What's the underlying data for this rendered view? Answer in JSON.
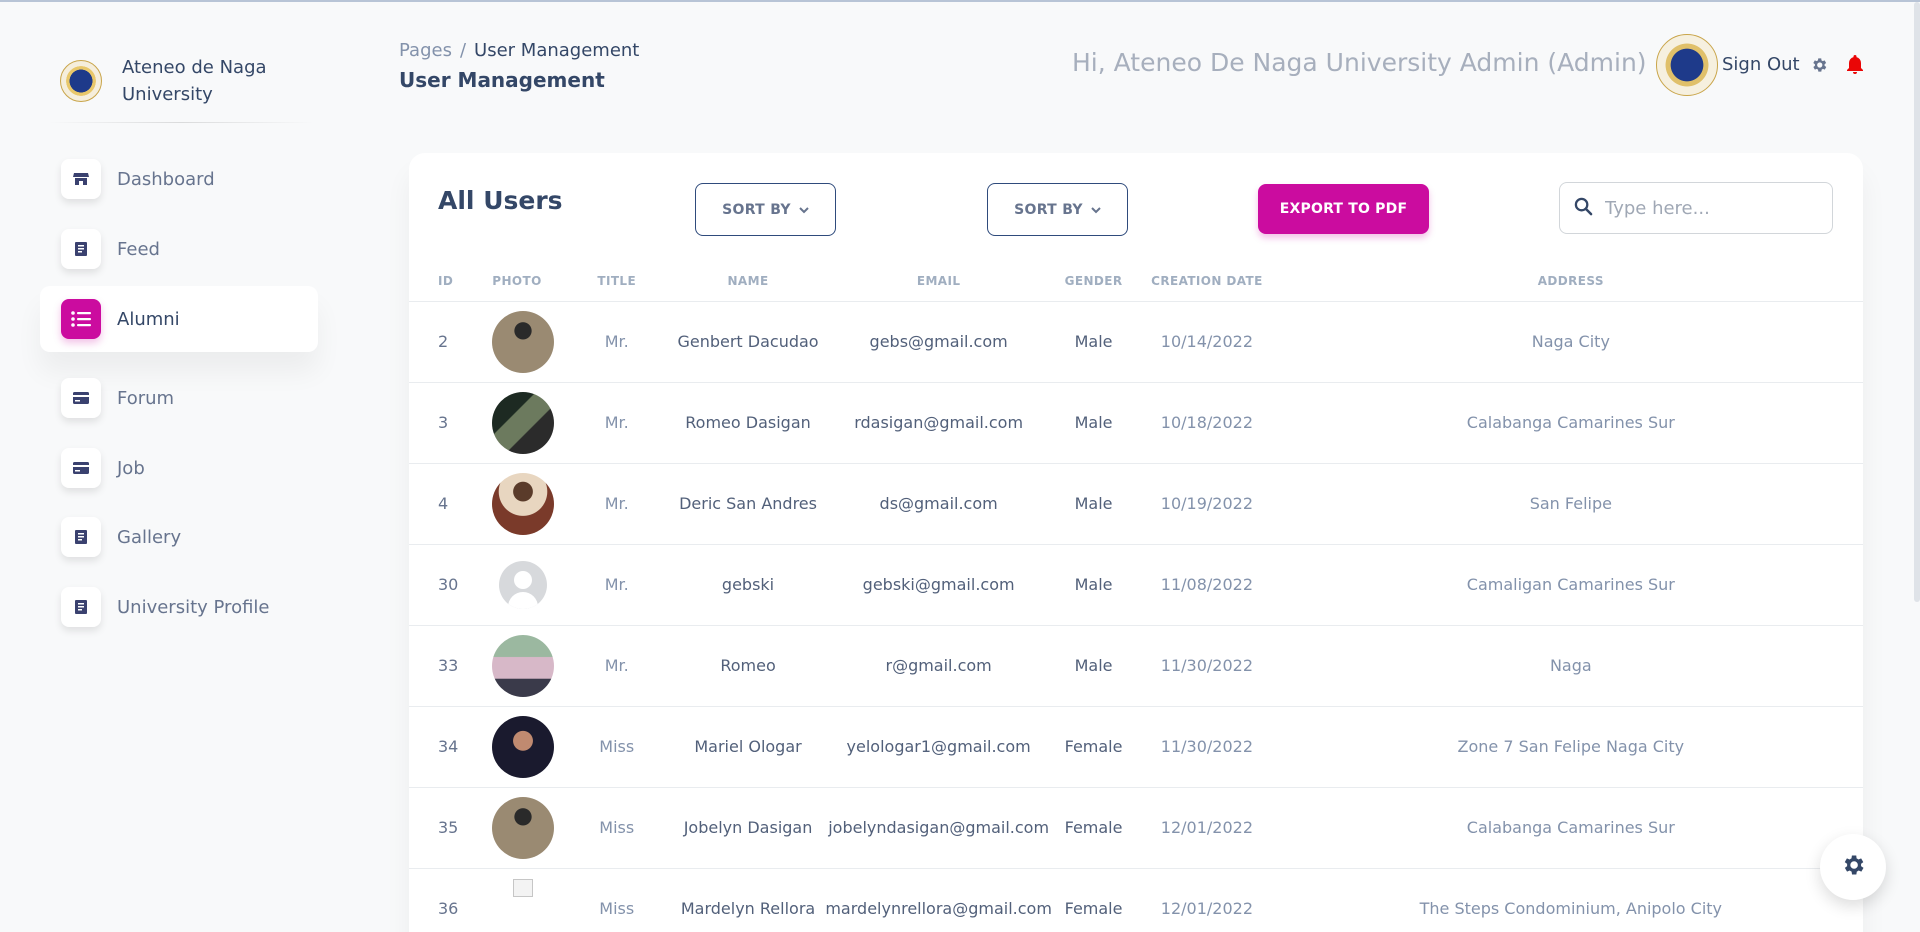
{
  "brand": {
    "name": "Ateneo de Naga University"
  },
  "sidebar": {
    "items": [
      {
        "label": "Dashboard",
        "icon": "shop-icon",
        "active": false
      },
      {
        "label": "Feed",
        "icon": "document-icon",
        "active": false
      },
      {
        "label": "Alumni",
        "icon": "list-icon",
        "active": true
      },
      {
        "label": "Forum",
        "icon": "credit-card-icon",
        "active": false
      },
      {
        "label": "Job",
        "icon": "credit-card-icon",
        "active": false
      },
      {
        "label": "Gallery",
        "icon": "document-icon",
        "active": false
      },
      {
        "label": "University Profile",
        "icon": "document-icon",
        "active": false
      }
    ]
  },
  "header": {
    "breadcrumb": {
      "root": "Pages",
      "separator": "/",
      "current": "User Management"
    },
    "title": "User Management",
    "greeting": "Hi, Ateneo De Naga University Admin (Admin)",
    "sign_out": "Sign Out"
  },
  "card": {
    "title": "All Users",
    "sort1": "SORT BY",
    "sort2": "SORT BY",
    "export": "EXPORT TO PDF",
    "search_placeholder": "Type here...",
    "columns": [
      "ID",
      "PHOTO",
      "TITLE",
      "NAME",
      "EMAIL",
      "GENDER",
      "CREATION DATE",
      "ADDRESS"
    ],
    "rows": [
      {
        "id": "2",
        "photo": "photo-1",
        "title": "Mr.",
        "name": "Genbert Dacudao",
        "email": "gebs@gmail.com",
        "gender": "Male",
        "date": "10/14/2022",
        "address": "Naga City"
      },
      {
        "id": "3",
        "photo": "photo-2",
        "title": "Mr.",
        "name": "Romeo Dasigan",
        "email": "rdasigan@gmail.com",
        "gender": "Male",
        "date": "10/18/2022",
        "address": "Calabanga Camarines Sur"
      },
      {
        "id": "4",
        "photo": "photo-3",
        "title": "Mr.",
        "name": "Deric San Andres",
        "email": "ds@gmail.com",
        "gender": "Male",
        "date": "10/19/2022",
        "address": "San Felipe"
      },
      {
        "id": "30",
        "photo": "default-avatar",
        "title": "Mr.",
        "name": "gebski",
        "email": "gebski@gmail.com",
        "gender": "Male",
        "date": "11/08/2022",
        "address": "Camaligan Camarines Sur"
      },
      {
        "id": "33",
        "photo": "photo-4",
        "title": "Mr.",
        "name": "Romeo",
        "email": "r@gmail.com",
        "gender": "Male",
        "date": "11/30/2022",
        "address": "Naga"
      },
      {
        "id": "34",
        "photo": "photo-5",
        "title": "Miss",
        "name": "Mariel Ologar",
        "email": "yelologar1@gmail.com",
        "gender": "Female",
        "date": "11/30/2022",
        "address": "Zone 7 San Felipe Naga City"
      },
      {
        "id": "35",
        "photo": "photo-1",
        "title": "Miss",
        "name": "Jobelyn Dasigan",
        "email": "jobelyndasigan@gmail.com",
        "gender": "Female",
        "date": "12/01/2022",
        "address": "Calabanga Camarines Sur"
      },
      {
        "id": "36",
        "photo": "broken-image",
        "title": "Miss",
        "name": "Mardelyn Rellora",
        "email": "mardelynrellora@gmail.com",
        "gender": "Female",
        "date": "12/01/2022",
        "address": "The Steps Condominium, Anipolo City"
      }
    ]
  },
  "colors": {
    "accent": "#cb0c9f",
    "text": "#344767",
    "muted": "#8392ab",
    "bell": "#ea0606"
  }
}
